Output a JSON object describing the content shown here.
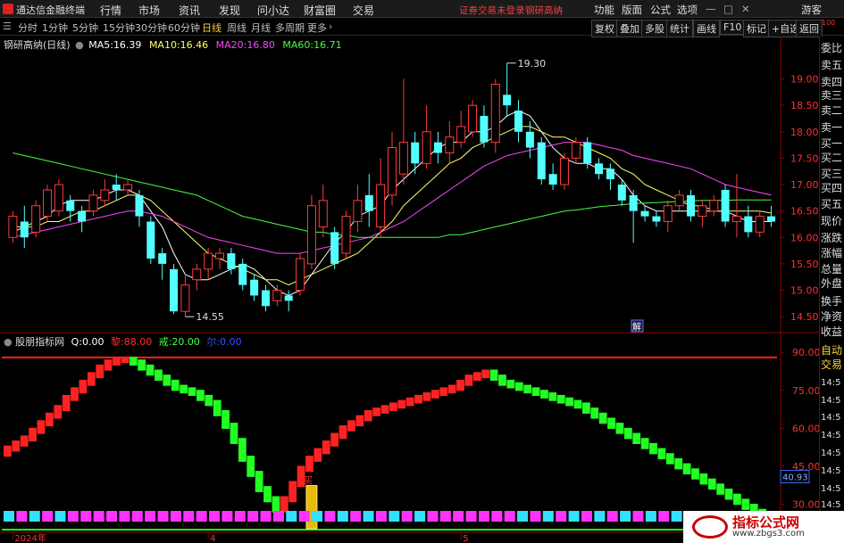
{
  "window": {
    "title": "通达信金融终端",
    "alert": "证券交易未登录",
    "stock_link": "钢研高纳"
  },
  "menu": [
    "行情",
    "市场",
    "资讯",
    "发现",
    "问小达",
    "财富圈",
    "交易"
  ],
  "right_menu": [
    "功能",
    "版面",
    "公式",
    "选项"
  ],
  "guest": "游客",
  "tabs": [
    "分时",
    "1分钟",
    "5分钟",
    "15分钟",
    "30分钟",
    "60分钟",
    "日线",
    "周线",
    "月线",
    "多周期",
    "更多"
  ],
  "active_tab": "日线",
  "toolbar": [
    "复权",
    "叠加",
    "多股",
    "统计",
    "画线",
    "F10",
    "标记",
    "+自选",
    "返回"
  ],
  "stock": {
    "name": "钢研高纳",
    "period": "(日线)"
  },
  "ma": [
    {
      "label": "MA5:",
      "value": "16.39",
      "color": "#ffffff"
    },
    {
      "label": "MA10:",
      "value": "16.46",
      "color": "#ffff66"
    },
    {
      "label": "MA20:",
      "value": "16.80",
      "color": "#ff44ff"
    },
    {
      "label": "MA60:",
      "value": "16.71",
      "color": "#44ff44"
    }
  ],
  "indicator": {
    "name": "股朋指标网",
    "items": [
      {
        "label": "Q:",
        "value": "0.00",
        "color": "#ffffff"
      },
      {
        "label": "黎:",
        "value": "88.00",
        "color": "#ff3030"
      },
      {
        "label": "戒:",
        "value": "20.00",
        "color": "#44ff44"
      },
      {
        "label": "尔:",
        "value": "0.00",
        "color": "#3050ff"
      }
    ],
    "current_badge": "40.93",
    "signal_label": "买"
  },
  "right_panel": [
    "委比",
    "卖五",
    "卖四",
    "卖三",
    "卖二",
    "卖一",
    "买一",
    "买二",
    "买三",
    "买四",
    "买五",
    "现价",
    "涨跌",
    "涨幅",
    "总量",
    "外盘",
    "换手",
    "净资",
    "收益"
  ],
  "right_panel_lower": [
    "自动",
    "交易",
    "14:5",
    "14:5",
    "14:5",
    "14:5",
    "14:5",
    "14:5",
    "14:5",
    "14:5"
  ],
  "top_badge": "100",
  "jie_badge": "解",
  "watermark": {
    "title": "指标公式网",
    "url": "www.zbgs3.com"
  },
  "chart_data": [
    {
      "type": "candlestick",
      "ylim": [
        14.3,
        19.6
      ],
      "yticks": [
        14.5,
        15.0,
        15.5,
        16.0,
        16.5,
        17.0,
        17.5,
        18.0,
        18.5,
        19.0
      ],
      "high_label": "19.30",
      "low_label": "14.55",
      "candles": [
        [
          16.0,
          16.4,
          15.9,
          16.5
        ],
        [
          16.3,
          16.0,
          15.8,
          16.6
        ],
        [
          16.1,
          16.6,
          16.0,
          16.7
        ],
        [
          16.4,
          16.9,
          16.3,
          17.0
        ],
        [
          16.5,
          17.0,
          16.4,
          17.1
        ],
        [
          16.7,
          16.5,
          16.3,
          16.8
        ],
        [
          16.5,
          16.3,
          16.1,
          16.6
        ],
        [
          16.5,
          16.8,
          16.4,
          16.9
        ],
        [
          16.7,
          16.9,
          16.6,
          17.1
        ],
        [
          17.0,
          16.9,
          16.7,
          17.2
        ],
        [
          16.9,
          17.0,
          16.8,
          17.1
        ],
        [
          16.8,
          16.4,
          16.2,
          16.9
        ],
        [
          16.3,
          15.6,
          15.5,
          16.4
        ],
        [
          15.7,
          15.5,
          15.2,
          15.8
        ],
        [
          15.4,
          14.6,
          14.55,
          15.5
        ],
        [
          14.6,
          15.1,
          14.5,
          15.3
        ],
        [
          15.2,
          15.4,
          15.0,
          15.5
        ],
        [
          15.4,
          15.7,
          15.2,
          15.8
        ],
        [
          15.6,
          15.7,
          15.4,
          15.8
        ],
        [
          15.7,
          15.4,
          15.3,
          15.8
        ],
        [
          15.5,
          15.1,
          15.0,
          15.6
        ],
        [
          15.2,
          14.9,
          14.8,
          15.3
        ],
        [
          15.0,
          14.7,
          14.6,
          15.1
        ],
        [
          14.8,
          15.0,
          14.7,
          15.1
        ],
        [
          14.9,
          14.8,
          14.6,
          15.0
        ],
        [
          15.0,
          15.6,
          14.9,
          15.7
        ],
        [
          15.5,
          16.6,
          15.4,
          16.8
        ],
        [
          16.2,
          16.7,
          16.0,
          17.0
        ],
        [
          16.1,
          15.5,
          15.4,
          16.2
        ],
        [
          15.7,
          16.4,
          15.6,
          16.5
        ],
        [
          16.3,
          16.7,
          16.1,
          17.0
        ],
        [
          16.8,
          16.5,
          16.2,
          17.2
        ],
        [
          16.2,
          17.0,
          16.0,
          17.5
        ],
        [
          16.8,
          17.7,
          16.6,
          18.0
        ],
        [
          17.2,
          17.8,
          17.0,
          19.0
        ],
        [
          17.8,
          17.4,
          17.2,
          18.0
        ],
        [
          17.4,
          18.0,
          17.3,
          18.5
        ],
        [
          17.8,
          17.6,
          17.4,
          18.0
        ],
        [
          17.6,
          17.9,
          17.4,
          18.2
        ],
        [
          17.8,
          18.1,
          17.7,
          18.4
        ],
        [
          18.0,
          18.5,
          17.9,
          18.6
        ],
        [
          18.3,
          17.8,
          17.7,
          18.5
        ],
        [
          17.8,
          18.9,
          17.6,
          19.0
        ],
        [
          18.7,
          18.5,
          18.3,
          19.3
        ],
        [
          18.4,
          18.0,
          17.8,
          18.6
        ],
        [
          18.0,
          17.7,
          17.5,
          18.2
        ],
        [
          17.8,
          17.1,
          17.0,
          17.9
        ],
        [
          17.2,
          17.0,
          16.9,
          17.4
        ],
        [
          17.0,
          17.5,
          16.9,
          17.6
        ],
        [
          17.5,
          17.8,
          17.4,
          17.9
        ],
        [
          17.8,
          17.4,
          17.3,
          17.9
        ],
        [
          17.4,
          17.2,
          17.1,
          17.5
        ],
        [
          17.3,
          17.1,
          16.9,
          17.4
        ],
        [
          17.0,
          16.7,
          16.6,
          17.1
        ],
        [
          16.8,
          16.5,
          15.9,
          16.9
        ],
        [
          16.5,
          16.4,
          16.3,
          16.6
        ],
        [
          16.4,
          16.3,
          16.2,
          16.5
        ],
        [
          16.3,
          16.6,
          16.1,
          16.7
        ],
        [
          16.6,
          16.8,
          16.5,
          16.9
        ],
        [
          16.8,
          16.4,
          16.3,
          16.9
        ],
        [
          16.4,
          16.6,
          16.2,
          16.7
        ],
        [
          16.5,
          16.7,
          16.4,
          16.8
        ],
        [
          16.9,
          16.3,
          16.2,
          17.0
        ],
        [
          16.3,
          16.4,
          16.0,
          17.2
        ],
        [
          16.4,
          16.1,
          16.0,
          16.6
        ],
        [
          16.1,
          16.4,
          16.0,
          16.5
        ],
        [
          16.4,
          16.3,
          16.2,
          16.6
        ]
      ],
      "series": [
        {
          "name": "MA5",
          "color": "#ffffff",
          "values": [
            16.1,
            16.2,
            16.3,
            16.4,
            16.6,
            16.7,
            16.7,
            16.7,
            16.8,
            16.9,
            16.9,
            16.8,
            16.5,
            16.2,
            15.7,
            15.3,
            15.2,
            15.2,
            15.3,
            15.4,
            15.5,
            15.4,
            15.2,
            15.0,
            14.9,
            15.0,
            15.3,
            15.6,
            15.9,
            16.1,
            16.4,
            16.5,
            16.6,
            16.9,
            17.1,
            17.3,
            17.5,
            17.7,
            17.8,
            17.8,
            18.0,
            18.0,
            18.1,
            18.3,
            18.4,
            18.3,
            18.0,
            17.7,
            17.5,
            17.4,
            17.4,
            17.3,
            17.3,
            17.1,
            16.8,
            16.6,
            16.5,
            16.5,
            16.5,
            16.5,
            16.5,
            16.5,
            16.5,
            16.4,
            16.3,
            16.3,
            16.3
          ]
        },
        {
          "name": "MA10",
          "color": "#ffff66",
          "values": [
            16.2,
            16.2,
            16.2,
            16.3,
            16.3,
            16.4,
            16.5,
            16.5,
            16.6,
            16.7,
            16.8,
            16.8,
            16.7,
            16.5,
            16.3,
            16.1,
            15.9,
            15.7,
            15.6,
            15.5,
            15.4,
            15.3,
            15.2,
            15.2,
            15.1,
            15.2,
            15.3,
            15.4,
            15.5,
            15.6,
            15.7,
            15.9,
            16.1,
            16.3,
            16.6,
            16.8,
            17.0,
            17.2,
            17.4,
            17.5,
            17.7,
            17.8,
            17.9,
            18.0,
            18.1,
            18.1,
            18.0,
            17.9,
            17.9,
            17.8,
            17.7,
            17.6,
            17.5,
            17.3,
            17.2,
            17.0,
            16.9,
            16.8,
            16.7,
            16.6,
            16.6,
            16.5,
            16.5,
            16.5,
            16.5,
            16.5,
            16.46
          ]
        },
        {
          "name": "MA20",
          "color": "#ff44ff",
          "values": [
            16.0,
            16.05,
            16.1,
            16.15,
            16.2,
            16.25,
            16.3,
            16.35,
            16.4,
            16.45,
            16.5,
            16.5,
            16.45,
            16.4,
            16.3,
            16.2,
            16.1,
            16.0,
            15.95,
            15.9,
            15.85,
            15.8,
            15.75,
            15.7,
            15.7,
            15.7,
            15.75,
            15.8,
            15.85,
            15.9,
            15.95,
            16.0,
            16.1,
            16.2,
            16.3,
            16.45,
            16.6,
            16.75,
            16.9,
            17.05,
            17.2,
            17.35,
            17.45,
            17.55,
            17.6,
            17.65,
            17.7,
            17.75,
            17.8,
            17.8,
            17.8,
            17.75,
            17.7,
            17.65,
            17.55,
            17.5,
            17.45,
            17.4,
            17.35,
            17.3,
            17.2,
            17.1,
            17.0,
            16.95,
            16.9,
            16.85,
            16.8
          ]
        },
        {
          "name": "MA60",
          "color": "#44ff44",
          "values": [
            17.6,
            17.55,
            17.5,
            17.45,
            17.4,
            17.35,
            17.3,
            17.25,
            17.2,
            17.15,
            17.1,
            17.05,
            17.0,
            16.95,
            16.9,
            16.85,
            16.8,
            16.7,
            16.6,
            16.5,
            16.4,
            16.35,
            16.3,
            16.25,
            16.2,
            16.15,
            16.1,
            16.1,
            16.05,
            16.05,
            16.0,
            16.0,
            16.0,
            16.0,
            16.0,
            16.0,
            16.0,
            16.0,
            16.05,
            16.05,
            16.1,
            16.15,
            16.2,
            16.25,
            16.3,
            16.35,
            16.4,
            16.45,
            16.5,
            16.52,
            16.55,
            16.58,
            16.6,
            16.62,
            16.64,
            16.65,
            16.66,
            16.67,
            16.68,
            16.69,
            16.7,
            16.7,
            16.7,
            16.71,
            16.71,
            16.71,
            16.71
          ]
        }
      ]
    },
    {
      "type": "bar",
      "ylim": [
        20,
        95
      ],
      "yticks": [
        30,
        45,
        60,
        75,
        90
      ],
      "upper_line": 88,
      "lower_line": 20,
      "signal_index": 26,
      "values": [
        52,
        54,
        56,
        59,
        62,
        65,
        68,
        72,
        75,
        78,
        81,
        84,
        86,
        87,
        87,
        86,
        84,
        82,
        80,
        78,
        76,
        75,
        74,
        72,
        70,
        66,
        61,
        55,
        48,
        42,
        36,
        32,
        28,
        32,
        38,
        44,
        48,
        51,
        54,
        57,
        60,
        62,
        64,
        66,
        67,
        68,
        69,
        70,
        71,
        72,
        73,
        74,
        75,
        76,
        78,
        80,
        81,
        82,
        80,
        78,
        77,
        76,
        75,
        74,
        73,
        72,
        71,
        70,
        69,
        67,
        65,
        63,
        61,
        59,
        57,
        55,
        53,
        51,
        49,
        47,
        45,
        43,
        41,
        39,
        37,
        35,
        33,
        31,
        29,
        27,
        25,
        23
      ]
    }
  ],
  "x_labels": [
    {
      "label": "2024年",
      "index": 0
    },
    {
      "label": "4",
      "index": 17
    },
    {
      "label": "5",
      "index": 39
    }
  ]
}
